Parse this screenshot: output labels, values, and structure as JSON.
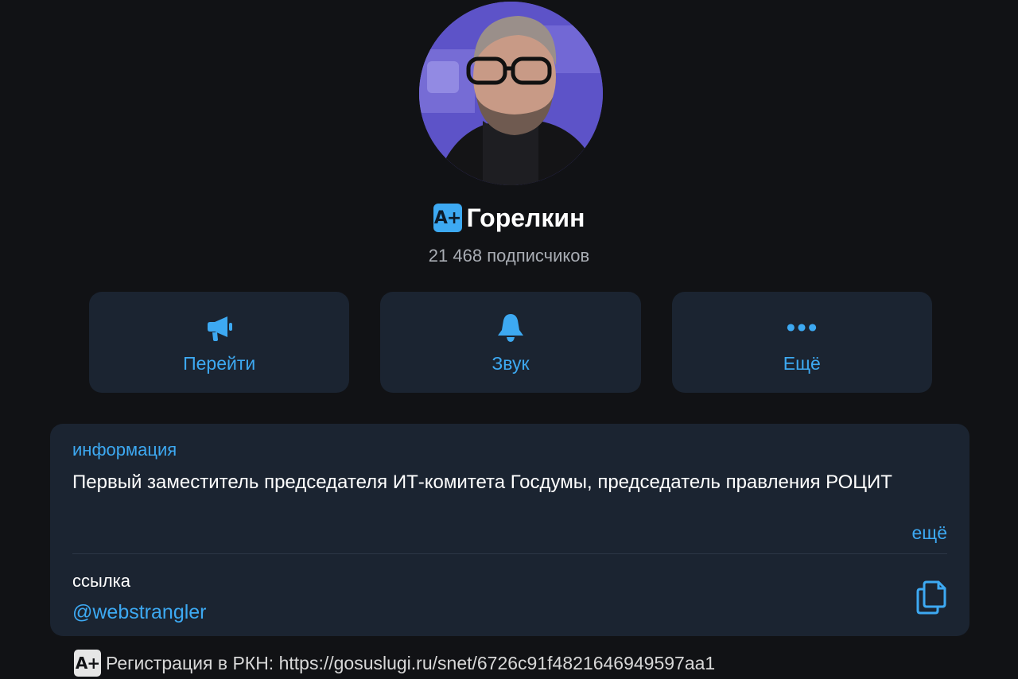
{
  "header": {
    "badge": "A+",
    "channel_name": "Горелкин",
    "subscribers": "21 468 подписчиков"
  },
  "actions": [
    {
      "label": "Перейти",
      "icon": "megaphone-icon"
    },
    {
      "label": "Звук",
      "icon": "bell-icon"
    },
    {
      "label": "Ещё",
      "icon": "more-dots-icon"
    }
  ],
  "info": {
    "heading": "информация",
    "text": "Первый заместитель председателя ИТ-комитета Госдумы, председатель правления РОЦИТ",
    "more_label": "ещё",
    "link_heading": "ссылка",
    "link_value": "@webstrangler",
    "copy_icon": "copy-icon"
  },
  "footer": {
    "badge": "A+",
    "text": "Регистрация в РКН: https://gosuslugi.ru/snet/6726c91f4821646949597aa1"
  },
  "colors": {
    "background": "#111215",
    "card": "#1b2431",
    "accent": "#3da9f2",
    "secondary_text": "#a9adb4"
  }
}
